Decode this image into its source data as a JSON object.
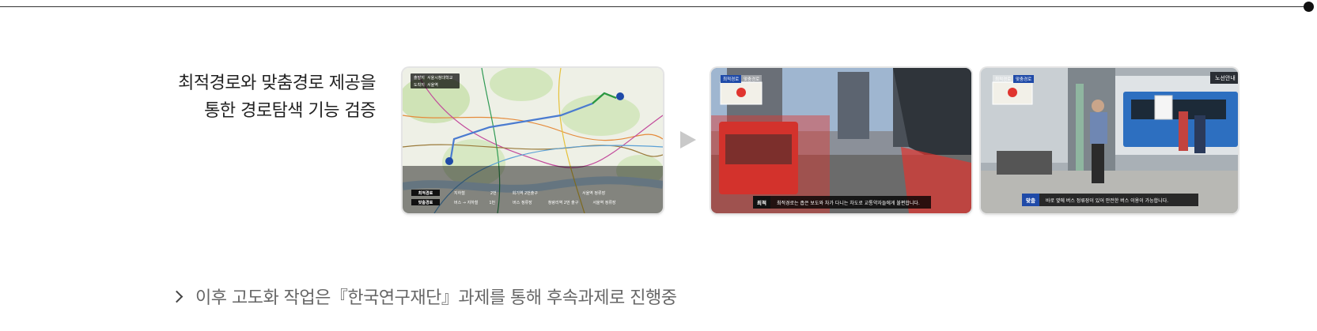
{
  "headline": {
    "line1": "최적경로와 맞춤경로 제공을",
    "line2": "통한 경로탐색 기능 검증"
  },
  "map_panel": {
    "origin_label": "출발지",
    "origin_value": "서울시청대학교",
    "destination_label": "도착지",
    "destination_value": "서울역",
    "routes": [
      {
        "tag": "최적경로",
        "cells": [
          "지하철",
          "2번",
          "회기역 2번출구",
          "서울역 정류장"
        ]
      },
      {
        "tag": "맞춤경로",
        "cells": [
          "버스 → 지하철",
          "1번",
          "버스 정류장",
          "청량리역 2번 출구",
          "서울역 정류장"
        ]
      }
    ]
  },
  "view1": {
    "tag_active": "최적경로",
    "tag_inactive": "맞춤경로",
    "caption_tag": "최적",
    "caption_text": "최적경로는 좁은 보도와 차가 다니는 차도로 교통약자들에게 불편합니다."
  },
  "view2": {
    "tag_inactive": "최적경로",
    "tag_active": "맞춤경로",
    "caption_tag": "맞춤",
    "caption_text": "바로 옆에 버스 정류장이 있어 안전한 버스 이용이 가능합니다.",
    "sign_text": "노선안내"
  },
  "bottom_note": "이후 고도화 작업은『한국연구재단』과제를 통해 후속과제로 진행중",
  "colors": {
    "route_blue": "#4a7bd0",
    "route_green": "#2b9a3c",
    "highlight_red": "#e0352f",
    "tag_blue": "#1f4aa8"
  }
}
